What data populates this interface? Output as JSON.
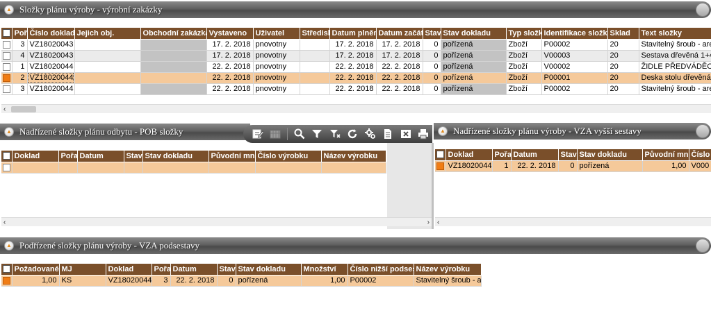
{
  "panel1": {
    "title": "Složky plánu výroby - výrobní zakázky",
    "columns": [
      "Poř",
      "Číslo doklad",
      "Jejich obj.",
      "Obchodní zakázka",
      "Vystaveno",
      "Uživatel",
      "Středisk",
      "Datum plněn",
      "Datum začát",
      "Stav",
      "Stav dokladu",
      "Typ složk",
      "Identifikace složky",
      "Sklad",
      "Text složky"
    ],
    "rows": [
      {
        "por": "3",
        "cislo": "VZ18020043",
        "jejich": "",
        "obchodni": "",
        "vystaveno": "17. 2. 2018",
        "uzivatel": "pnovotny",
        "stredisko": "",
        "datum_plneni": "17. 2. 2018",
        "datum_zacatku": "17. 2. 2018",
        "stav": "0",
        "stav_dokladu": "pořízená",
        "typ": "Zboží",
        "identifikace": "P00002",
        "sklad": "20",
        "text": "Stavitelný šroub - are"
      },
      {
        "por": "4",
        "cislo": "VZ18020043",
        "jejich": "",
        "obchodni": "",
        "vystaveno": "17. 2. 2018",
        "uzivatel": "pnovotny",
        "stredisko": "",
        "datum_plneni": "17. 2. 2018",
        "datum_zacatku": "17. 2. 2018",
        "stav": "0",
        "stav_dokladu": "pořízená",
        "typ": "Zboží",
        "identifikace": "V00003",
        "sklad": "20",
        "text": "Sestava dřevěná 1+4"
      },
      {
        "por": "1",
        "cislo": "VZ18020044",
        "jejich": "",
        "obchodni": "",
        "vystaveno": "22. 2. 2018",
        "uzivatel": "pnovotny",
        "stredisko": "",
        "datum_plneni": "22. 2. 2018",
        "datum_zacatku": "22. 2. 2018",
        "stav": "0",
        "stav_dokladu": "pořízená",
        "typ": "Zboží",
        "identifikace": "V00002",
        "sklad": "20",
        "text": "ŽIDLE PŘEDVÁDĚC"
      },
      {
        "por": "2",
        "cislo": "VZ18020044",
        "jejich": "",
        "obchodni": "",
        "vystaveno": "22. 2. 2018",
        "uzivatel": "pnovotny",
        "stredisko": "",
        "datum_plneni": "22. 2. 2018",
        "datum_zacatku": "22. 2. 2018",
        "stav": "0",
        "stav_dokladu": "pořízená",
        "typ": "Zboží",
        "identifikace": "P00001",
        "sklad": "20",
        "text": "Deska stolu dřevěná"
      },
      {
        "por": "3",
        "cislo": "VZ18020044",
        "jejich": "",
        "obchodni": "",
        "vystaveno": "22. 2. 2018",
        "uzivatel": "pnovotny",
        "stredisko": "",
        "datum_plneni": "22. 2. 2018",
        "datum_zacatku": "22. 2. 2018",
        "stav": "0",
        "stav_dokladu": "pořízená",
        "typ": "Zboží",
        "identifikace": "P00002",
        "sklad": "20",
        "text": "Stavitelný šroub - are"
      }
    ],
    "selected_row": 3
  },
  "panel2": {
    "title": "Nadřízené složky plánu odbytu - POB složky",
    "columns": [
      "Doklad",
      "Pořa",
      "Datum",
      "Stav",
      "Stav dokladu",
      "Původní mn",
      "Číslo výrobku",
      "Název výrobku"
    ]
  },
  "toolbar": {
    "icons": [
      "edit-icon",
      "calendar-icon",
      "search-icon",
      "filter-icon",
      "clear-filter-icon",
      "refresh-icon",
      "configure-icon",
      "document-icon",
      "excel-icon",
      "print-icon"
    ]
  },
  "panel3": {
    "title": "Nadřízené složky plánu výroby  - VZA vyšší sestavy",
    "columns": [
      "Doklad",
      "Pořa",
      "Datum",
      "Stav",
      "Stav dokladu",
      "Původní mn",
      "Číslo"
    ],
    "rows": [
      {
        "doklad": "VZ18020044",
        "pora": "1",
        "datum": "22. 2. 2018",
        "stav": "0",
        "stav_dokladu": "pořízená",
        "puvodni": "1,00",
        "cislo": "V000"
      }
    ]
  },
  "panel4": {
    "title": "Podřízené složky plánu výroby - VZA podsestavy",
    "columns": [
      "Požadované",
      "MJ",
      "Doklad",
      "Pořa",
      "Datum",
      "Stav",
      "Stav dokladu",
      "Množství",
      "Číslo nižší podsest",
      "Název výrobku"
    ],
    "rows": [
      {
        "pozadovane": "1,00",
        "mj": "KS",
        "doklad": "VZ18020044",
        "pora": "3",
        "datum": "22. 2. 2018",
        "stav": "0",
        "stav_dokladu": "pořízená",
        "mnozstvi": "1,00",
        "cislo": "P00002",
        "nazev": "Stavitelný šroub - are"
      }
    ]
  },
  "colors": {
    "header_brown": "#7a4f2a",
    "selection": "#f5c99a",
    "checkbox_on": "#f07c14",
    "title_bar": "#5f5f5f"
  }
}
